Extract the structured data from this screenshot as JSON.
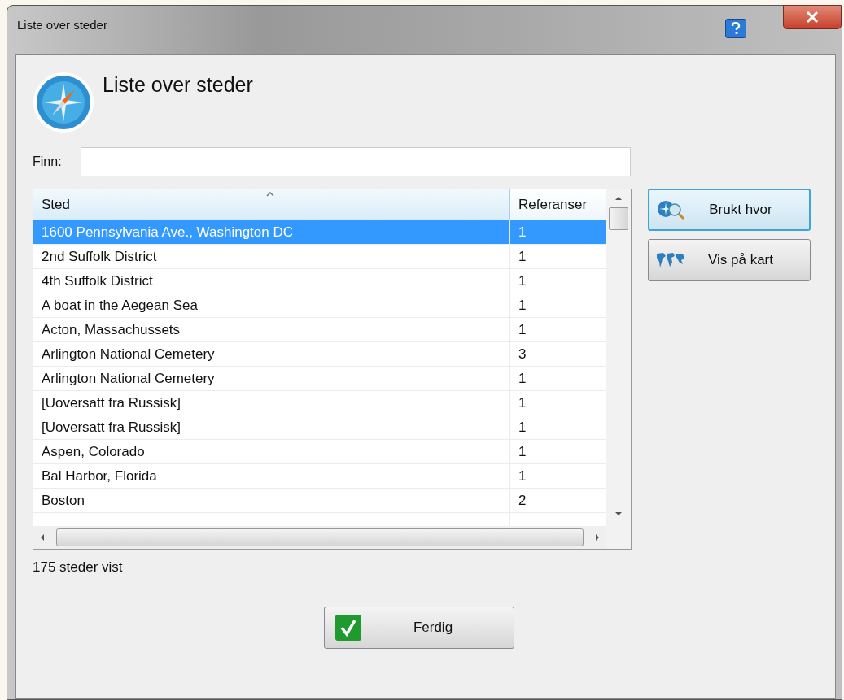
{
  "window": {
    "title": "Liste over steder"
  },
  "heading": "Liste over steder",
  "search": {
    "label": "Finn:"
  },
  "table": {
    "columns": [
      {
        "label": "Sted",
        "sorted": true
      },
      {
        "label": "Referanser",
        "sorted": false
      }
    ],
    "rows": [
      {
        "place": "1600 Pennsylvania Ave., Washington DC",
        "references": "1",
        "selected": true
      },
      {
        "place": "2nd Suffolk District",
        "references": "1",
        "selected": false
      },
      {
        "place": "4th Suffolk District",
        "references": "1",
        "selected": false
      },
      {
        "place": "A boat in the Aegean Sea",
        "references": "1",
        "selected": false
      },
      {
        "place": "Acton, Massachussets",
        "references": "1",
        "selected": false
      },
      {
        "place": "Arlington National Cemetery",
        "references": "3",
        "selected": false
      },
      {
        "place": "Arlington National Cemetery",
        "references": "1",
        "selected": false
      },
      {
        "place": "[Uoversatt fra Russisk]",
        "references": "1",
        "selected": false
      },
      {
        "place": "[Uoversatt fra Russisk]",
        "references": "1",
        "selected": false
      },
      {
        "place": "Aspen, Colorado",
        "references": "1",
        "selected": false
      },
      {
        "place": "Bal Harbor, Florida",
        "references": "1",
        "selected": false
      },
      {
        "place": "Boston",
        "references": "2",
        "selected": false
      }
    ]
  },
  "side_buttons": [
    {
      "label": "Brukt hvor",
      "kind": "usage",
      "focused": true
    },
    {
      "label": "Vis på kart",
      "kind": "map",
      "focused": false
    }
  ],
  "status": "175 steder vist",
  "ok_button": "Ferdig"
}
